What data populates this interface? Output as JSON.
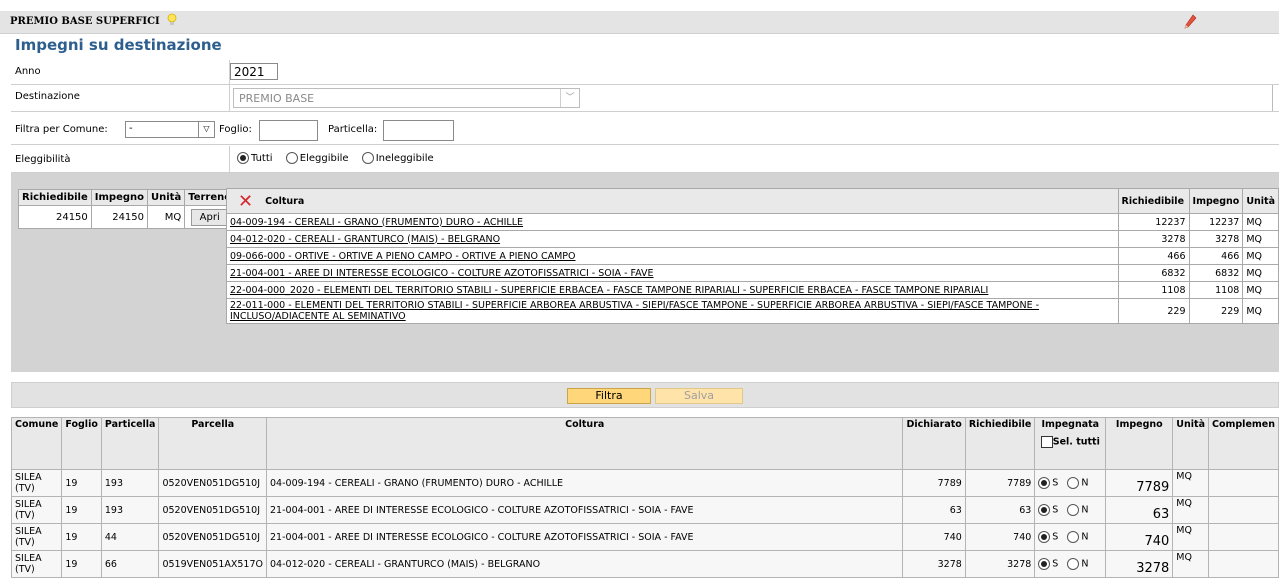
{
  "header": {
    "title": "PREMIO BASE SUPERFICI",
    "subtitle": "Impegni su destinazione"
  },
  "form": {
    "anno": {
      "label": "Anno",
      "value": "2021"
    },
    "destinazione": {
      "label": "Destinazione",
      "value": "PREMIO BASE"
    },
    "filtro": {
      "comune_label": "Filtra per Comune:",
      "comune_value": "-",
      "foglio_label": "Foglio:",
      "foglio_value": "",
      "particella_label": "Particella:",
      "particella_value": ""
    },
    "eleggibilita": {
      "label": "Eleggibilità",
      "options": [
        "Tutti",
        "Eleggibile",
        "Ineleggibile"
      ],
      "selected": "Tutti"
    }
  },
  "summary_table": {
    "headers": [
      "Richiedibile",
      "Impegno",
      "Unità",
      "Terreno"
    ],
    "row": {
      "richiedibile": "24150",
      "impegno": "24150",
      "unita": "MQ",
      "button": "Apri"
    }
  },
  "coltura_table": {
    "headers": {
      "coltura": "Coltura",
      "richiedibile": "Richiedibile",
      "impegno": "Impegno",
      "unita": "Unità"
    },
    "rows": [
      {
        "coltura": "04-009-194 - CEREALI - GRANO (FRUMENTO) DURO - ACHILLE",
        "richiedibile": "12237",
        "impegno": "12237",
        "unita": "MQ"
      },
      {
        "coltura": "04-012-020 - CEREALI - GRANTURCO (MAIS) - BELGRANO",
        "richiedibile": "3278",
        "impegno": "3278",
        "unita": "MQ"
      },
      {
        "coltura": "09-066-000 - ORTIVE - ORTIVE A PIENO CAMPO - ORTIVE A PIENO CAMPO",
        "richiedibile": "466",
        "impegno": "466",
        "unita": "MQ"
      },
      {
        "coltura": "21-004-001 - AREE DI INTERESSE ECOLOGICO - COLTURE AZOTOFISSATRICI - SOIA - FAVE",
        "richiedibile": "6832",
        "impegno": "6832",
        "unita": "MQ"
      },
      {
        "coltura": "22-004-000_2020 - ELEMENTI DEL TERRITORIO STABILI - SUPERFICIE ERBACEA - FASCE TAMPONE RIPARIALI - SUPERFICIE ERBACEA - FASCE TAMPONE RIPARIALI",
        "richiedibile": "1108",
        "impegno": "1108",
        "unita": "MQ"
      },
      {
        "coltura": "22-011-000 - ELEMENTI DEL TERRITORIO STABILI - SUPERFICIE ARBOREA ARBUSTIVA - SIEPI/FASCE TAMPONE - SUPERFICIE ARBOREA ARBUSTIVA - SIEPI/FASCE TAMPONE -INCLUSO/ADIACENTE AL SEMINATIVO",
        "richiedibile": "229",
        "impegno": "229",
        "unita": "MQ"
      }
    ]
  },
  "buttons": {
    "filtra": "Filtra",
    "salva": "Salva"
  },
  "main_table": {
    "headers": {
      "comune": "Comune",
      "foglio": "Foglio",
      "particella": "Particella",
      "parcella": "Parcella",
      "coltura": "Coltura",
      "dichiarato": "Dichiarato",
      "richiedibile": "Richiedibile",
      "impegnata": "Impegnata",
      "sel_tutti": "Sel. tutti",
      "impegno": "Impegno",
      "unita": "Unità",
      "complemento": "Complemen"
    },
    "radio_labels": {
      "s": "S",
      "n": "N"
    },
    "rows": [
      {
        "comune": "SILEA (TV)",
        "foglio": "19",
        "particella": "193",
        "parcella": "0520VEN051DG510J",
        "coltura": "04-009-194 - CEREALI - GRANO (FRUMENTO) DURO - ACHILLE",
        "dichiarato": "7789",
        "richiedibile": "7789",
        "impegno": "7789",
        "unita": "MQ"
      },
      {
        "comune": "SILEA (TV)",
        "foglio": "19",
        "particella": "193",
        "parcella": "0520VEN051DG510J",
        "coltura": "21-004-001 - AREE DI INTERESSE ECOLOGICO - COLTURE AZOTOFISSATRICI - SOIA - FAVE",
        "dichiarato": "63",
        "richiedibile": "63",
        "impegno": "63",
        "unita": "MQ"
      },
      {
        "comune": "SILEA (TV)",
        "foglio": "19",
        "particella": "44",
        "parcella": "0520VEN051DG510J",
        "coltura": "21-004-001 - AREE DI INTERESSE ECOLOGICO - COLTURE AZOTOFISSATRICI - SOIA - FAVE",
        "dichiarato": "740",
        "richiedibile": "740",
        "impegno": "740",
        "unita": "MQ"
      },
      {
        "comune": "SILEA (TV)",
        "foglio": "19",
        "particella": "66",
        "parcella": "0519VEN051AX517O",
        "coltura": "04-012-020 - CEREALI - GRANTURCO (MAIS) - BELGRANO",
        "dichiarato": "3278",
        "richiedibile": "3278",
        "impegno": "3278",
        "unita": "MQ"
      }
    ]
  }
}
